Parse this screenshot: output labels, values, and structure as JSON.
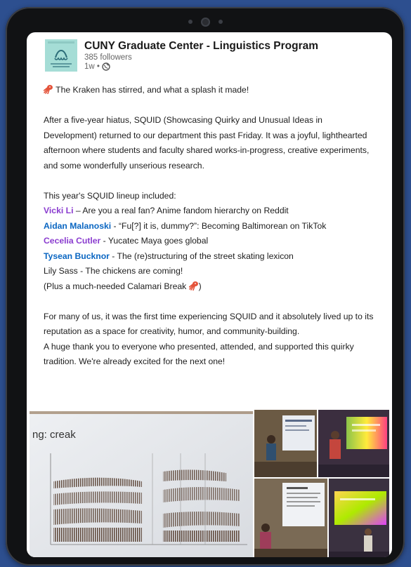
{
  "post": {
    "org_name": "CUNY Graduate Center - Linguistics Program",
    "followers": "385 followers",
    "time": "1w •",
    "intro": "The Kraken has stirred, and what a splash it made!",
    "para1": "After a five-year hiatus, SQUID (Showcasing Quirky and Unusual Ideas in Development) returned to our department this past Friday. It was a joyful, lighthearted afternoon where students and faculty shared works-in-progress, creative experiments, and some wonderfully unserious research.",
    "lineup_heading": "This year's SQUID lineup included:",
    "lineup": [
      {
        "name": "Vicki Li",
        "title": " – Are you a real fan? Anime fandom hierarchy on Reddit"
      },
      {
        "name": "Aidan Malanoski",
        "title": " - “Fu[?] it is, dummy?”: Becoming Baltimorean on TikTok"
      },
      {
        "name": "Cecelia Cutler",
        "title": " - Yucatec Maya goes global"
      },
      {
        "name": "Tysean Bucknor",
        "title": " - The (re)structuring of the street skating lexicon"
      }
    ],
    "lily": "Lily Sass - The chickens are coming!",
    "calamari": "(Plus a much-needed Calamari Break ",
    "calamari_close": ")",
    "para2": "For many of us, it was the first time experiencing SQUID and it absolutely lived up to its reputation as a space for creativity, humor, and community-building.",
    "para3": "A huge thank you to everyone who presented, attended, and supported this quirky tradition. We're already excited for the next one!"
  },
  "photo": {
    "slide_text": "ng: creak"
  },
  "icons": {
    "kraken": "squid-emoji-icon",
    "globe": "globe-icon"
  },
  "colors": {
    "background": "#2d4f8f",
    "name_purple": "#8a3ccf",
    "name_blue": "#0a66c2"
  }
}
